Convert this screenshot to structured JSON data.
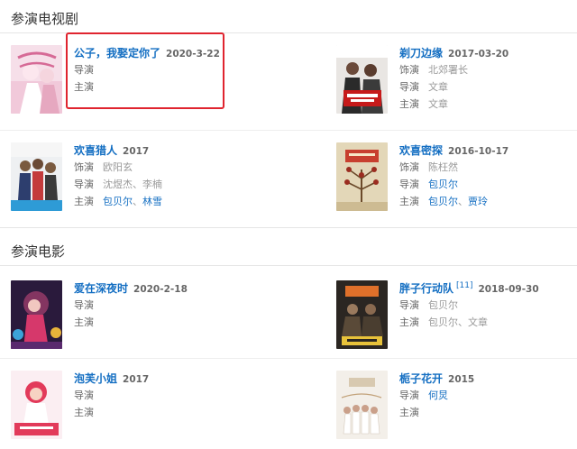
{
  "sections": {
    "tv": {
      "title": "参演电视剧"
    },
    "film": {
      "title": "参演电影"
    }
  },
  "labels": {
    "actor": "饰演",
    "director": "导演",
    "lead": "主演"
  },
  "sep_comma": "、",
  "tv_items": [
    {
      "title": "公子，我娶定你了",
      "date": "2020-3-22"
    },
    {
      "title": "剃刀边缘",
      "date": "2017-03-20",
      "actor": "北郊署长",
      "director": "文章",
      "lead": "文章"
    },
    {
      "title": "欢喜猎人",
      "date": "2017",
      "actor": "欧阳玄",
      "director": "沈煜杰、李楠",
      "lead1": "包贝尔",
      "lead2": "林雪"
    },
    {
      "title": "欢喜密探",
      "date": "2016-10-17",
      "actor": "陈枉然",
      "director": "包贝尔",
      "lead1": "包贝尔",
      "lead2": "贾玲"
    }
  ],
  "film_items": [
    {
      "title": "爱在深夜时",
      "date": "2020-2-18"
    },
    {
      "title": "胖子行动队",
      "sup": "[11]",
      "date": "2018-09-30",
      "director": "包贝尔",
      "lead": "包贝尔、文章"
    },
    {
      "title": "泡芙小姐",
      "date": "2017"
    },
    {
      "title": "栀子花开",
      "date": "2015",
      "director": "何炅"
    }
  ],
  "colors": {
    "link": "#136ec2",
    "highlight": "#e0242f",
    "muted": "#999999"
  }
}
